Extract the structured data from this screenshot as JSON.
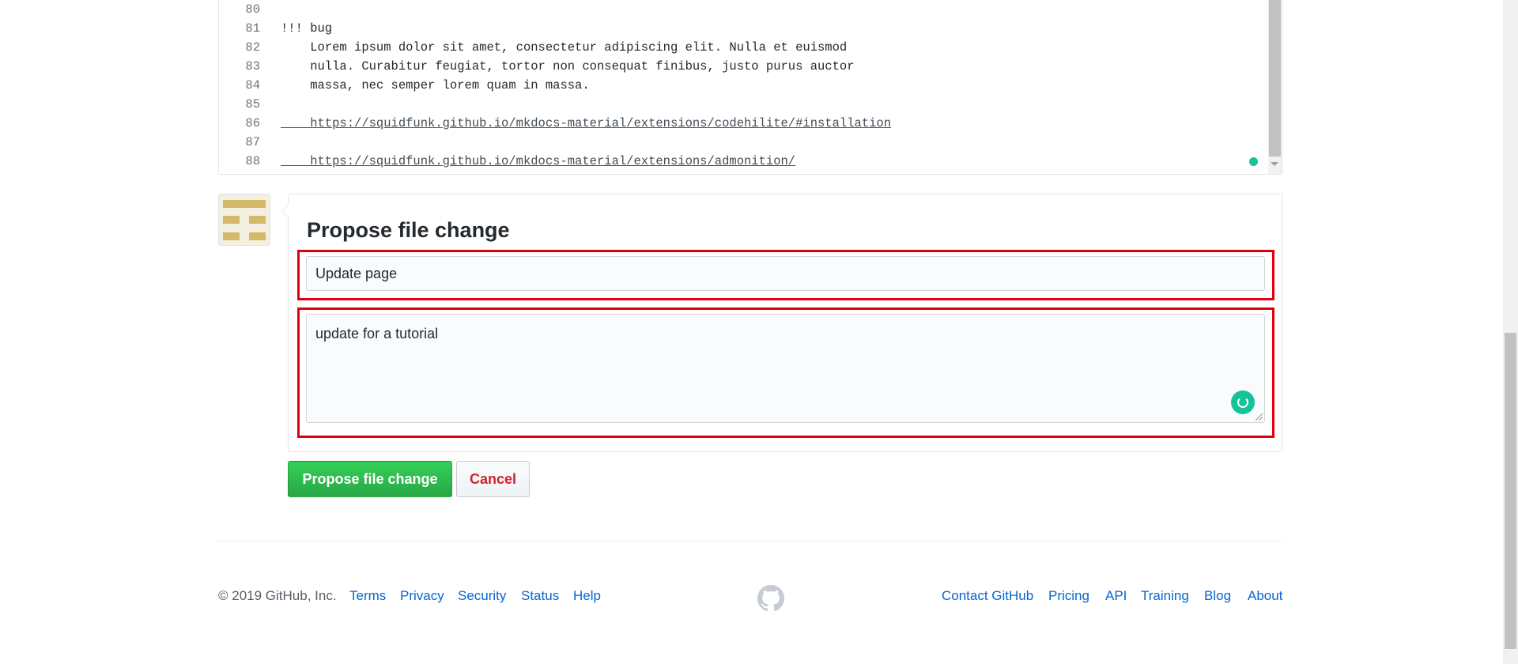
{
  "editor": {
    "lines": [
      {
        "num": "80",
        "text": ""
      },
      {
        "num": "81",
        "text": "!!! bug"
      },
      {
        "num": "82",
        "text": "    Lorem ipsum dolor sit amet, consectetur adipiscing elit. Nulla et euismod"
      },
      {
        "num": "83",
        "text": "    nulla. Curabitur feugiat, tortor non consequat finibus, justo purus auctor"
      },
      {
        "num": "84",
        "text": "    massa, nec semper lorem quam in massa."
      },
      {
        "num": "85",
        "text": ""
      },
      {
        "num": "86",
        "text": "    https://squidfunk.github.io/mkdocs-material/extensions/codehilite/#installation"
      },
      {
        "num": "87",
        "text": ""
      },
      {
        "num": "88",
        "text": "    https://squidfunk.github.io/mkdocs-material/extensions/admonition/"
      }
    ]
  },
  "propose": {
    "title": "Propose file change",
    "summary_value": "Update page",
    "description_value": "update for a tutorial",
    "submit_label": "Propose file change",
    "cancel_label": "Cancel"
  },
  "footer": {
    "copyright": "© 2019 GitHub, Inc.",
    "left_links": [
      "Terms",
      "Privacy",
      "Security",
      "Status",
      "Help"
    ],
    "right_links": [
      "Contact GitHub",
      "Pricing",
      "API",
      "Training",
      "Blog",
      "About"
    ]
  },
  "colors": {
    "primary_button": "#28a745",
    "cancel_text": "#cb2431",
    "link": "#0366d6",
    "highlight_border": "#e00010",
    "grammarly": "#15c39a"
  },
  "icons": [
    "grammarly-icon",
    "github-logo-icon",
    "avatar-identicon"
  ]
}
